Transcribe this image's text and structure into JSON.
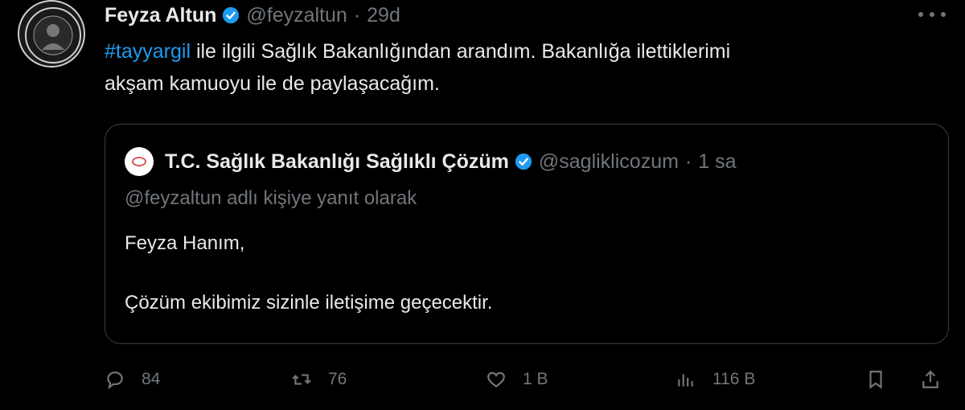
{
  "tweet": {
    "author_name": "Feyza Altun",
    "author_handle": "@feyzaltun",
    "separator": "·",
    "time": "29d",
    "hashtag": "#tayyargil",
    "text_line1_rest": " ile ilgili Sağlık Bakanlığından arandım. Bakanlığa ilettiklerimi",
    "text_line2": "akşam kamuoyu ile de paylaşacağım."
  },
  "quote": {
    "author_name": "T.C. Sağlık Bakanlığı Sağlıklı Çözüm",
    "author_handle": "@sagliklicozum",
    "separator": "·",
    "time": "1 sa",
    "reply_context": "@feyzaltun adlı kişiye yanıt olarak",
    "body_line1": "Feyza Hanım,",
    "body_line2": "Çözüm ekibimiz sizinle iletişime geçecektir."
  },
  "actions": {
    "replies": "84",
    "reposts": "76",
    "likes": "1 B",
    "views": "116 B"
  },
  "colors": {
    "background": "#000000",
    "text": "#e7e9ea",
    "secondary": "#71767b",
    "accent": "#1d9bf0",
    "border": "#3a3e42"
  }
}
